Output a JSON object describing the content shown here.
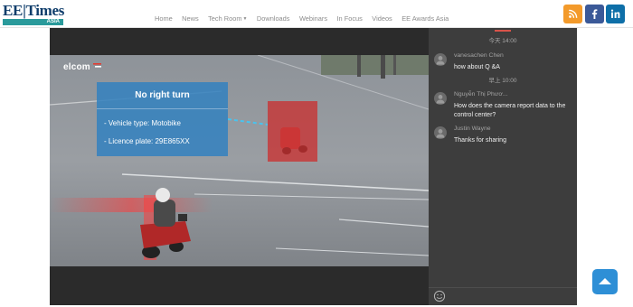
{
  "brand": {
    "logo_main": "EE|Times",
    "logo_sub": "ASIA"
  },
  "nav": {
    "items": [
      "Home",
      "News",
      "Tech Room",
      "Downloads",
      "Webinars",
      "In Focus",
      "Videos",
      "EE Awards Asia"
    ]
  },
  "social": {
    "rss": {
      "icon": "rss-icon",
      "color": "#f39a2b"
    },
    "facebook": {
      "icon": "facebook-icon",
      "color": "#3b5998"
    },
    "linkedin": {
      "icon": "linkedin-icon",
      "color": "#0e6fa8"
    }
  },
  "video": {
    "brand_label": "elcom",
    "overlay": {
      "title": "No right turn",
      "lines": [
        "- Vehicle type: Motobike",
        "- Licence plate: 29E865XX"
      ]
    }
  },
  "chat": {
    "accent_color": "#d8534a",
    "entries": [
      {
        "type": "time",
        "text": "今天 14:00"
      },
      {
        "type": "message",
        "author": "vanesachen Chen",
        "text": "how about Q &A"
      },
      {
        "type": "time",
        "text": "早上 10:00"
      },
      {
        "type": "message",
        "author": "Nguyễn Thị Phươ...",
        "text": "How does the camera report data to the control center?"
      },
      {
        "type": "message",
        "author": "Justin Wayne",
        "text": "Thanks for sharing"
      }
    ]
  },
  "colors": {
    "chat_bg": "#3d3d3d",
    "player_bg": "#2b2b2b",
    "back_to_top": "#2e8fd6"
  }
}
